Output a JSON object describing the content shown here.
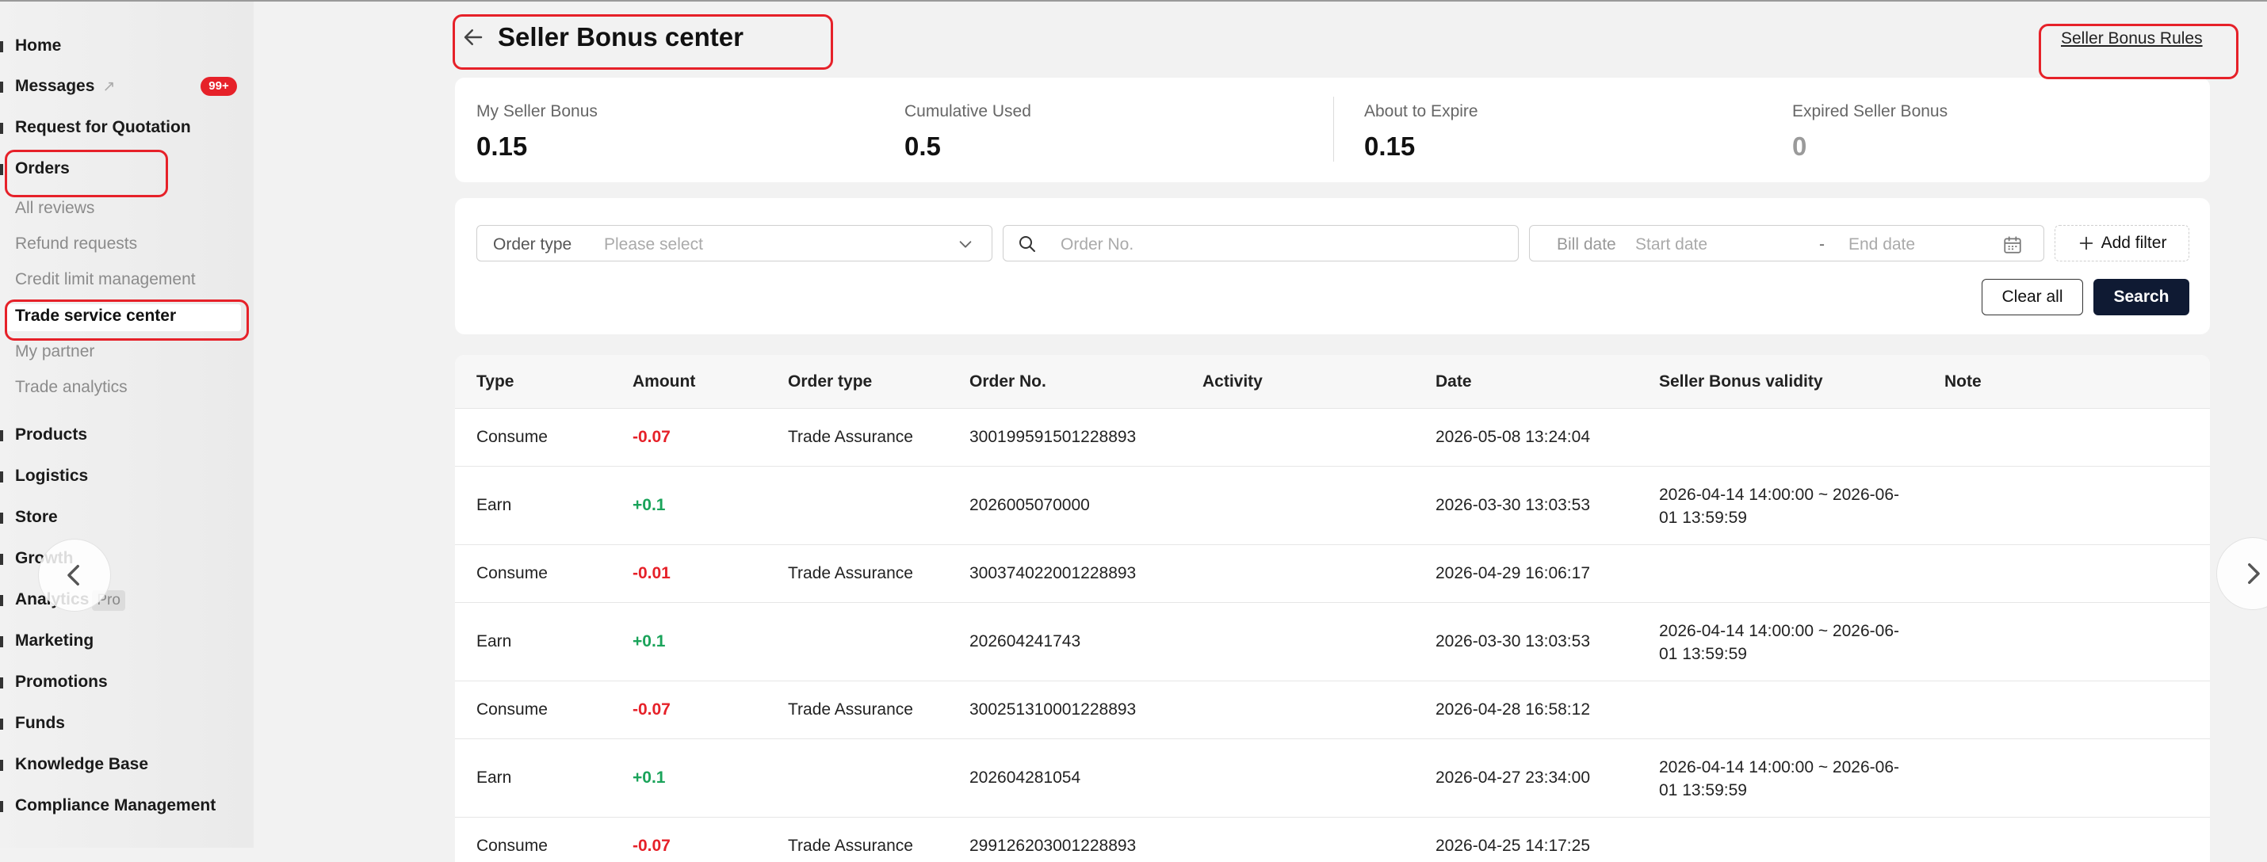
{
  "sidebar": {
    "items": [
      {
        "label": "Home"
      },
      {
        "label": "Messages",
        "badge": "99+"
      },
      {
        "label": "Request for Quotation"
      },
      {
        "label": "Orders"
      },
      {
        "label": "Products"
      },
      {
        "label": "Logistics"
      },
      {
        "label": "Store"
      },
      {
        "label": "Growth"
      },
      {
        "label": "Analytics",
        "tag": "Pro"
      },
      {
        "label": "Marketing"
      },
      {
        "label": "Promotions"
      },
      {
        "label": "Funds"
      },
      {
        "label": "Knowledge Base"
      },
      {
        "label": "Compliance Management"
      }
    ],
    "orders_sub": [
      {
        "label": "All reviews"
      },
      {
        "label": "Refund requests"
      },
      {
        "label": "Credit limit management"
      },
      {
        "label": "Trade service center",
        "active": true
      },
      {
        "label": "My partner"
      },
      {
        "label": "Trade analytics"
      }
    ]
  },
  "header": {
    "title": "Seller Bonus center",
    "rules_link": "Seller Bonus Rules"
  },
  "stats": [
    {
      "label": "My Seller Bonus",
      "value": "0.15"
    },
    {
      "label": "Cumulative Used",
      "value": "0.5"
    },
    {
      "label": "About to Expire",
      "value": "0.15"
    },
    {
      "label": "Expired Seller Bonus",
      "value": "0"
    }
  ],
  "filters": {
    "order_type_label": "Order type",
    "order_type_placeholder": "Please select",
    "order_no_placeholder": "Order No.",
    "bill_date_label": "Bill date",
    "start_date_placeholder": "Start date",
    "date_separator": "-",
    "end_date_placeholder": "End date",
    "add_filter": "Add filter",
    "clear_all": "Clear all",
    "search": "Search"
  },
  "table": {
    "columns": [
      "Type",
      "Amount",
      "Order type",
      "Order No.",
      "Activity",
      "Date",
      "Seller Bonus validity",
      "Note"
    ],
    "rows": [
      {
        "type": "Consume",
        "amount": "-0.07",
        "order_type": "Trade Assurance",
        "order_no": "300199591501228893",
        "activity": "",
        "date": "2026-05-08 13:24:04",
        "validity": "",
        "note": ""
      },
      {
        "type": "Earn",
        "amount": "+0.1",
        "order_type": "",
        "order_no": "2026005070000",
        "activity": "",
        "date": "2026-03-30 13:03:53",
        "validity": "2026-04-14 14:00:00 ~ 2026-06-01 13:59:59",
        "note": ""
      },
      {
        "type": "Consume",
        "amount": "-0.01",
        "order_type": "Trade Assurance",
        "order_no": "300374022001228893",
        "activity": "",
        "date": "2026-04-29 16:06:17",
        "validity": "",
        "note": ""
      },
      {
        "type": "Earn",
        "amount": "+0.1",
        "order_type": "",
        "order_no": "202604241743",
        "activity": "",
        "date": "2026-03-30 13:03:53",
        "validity": "2026-04-14 14:00:00 ~ 2026-06-01 13:59:59",
        "note": ""
      },
      {
        "type": "Consume",
        "amount": "-0.07",
        "order_type": "Trade Assurance",
        "order_no": "300251310001228893",
        "activity": "",
        "date": "2026-04-28 16:58:12",
        "validity": "",
        "note": ""
      },
      {
        "type": "Earn",
        "amount": "+0.1",
        "order_type": "",
        "order_no": "202604281054",
        "activity": "",
        "date": "2026-04-27 23:34:00",
        "validity": "2026-04-14 14:00:00 ~ 2026-06-01 13:59:59",
        "note": ""
      },
      {
        "type": "Consume",
        "amount": "-0.07",
        "order_type": "Trade Assurance",
        "order_no": "299126203001228893",
        "activity": "",
        "date": "2026-04-25 14:17:25",
        "validity": "",
        "note": ""
      }
    ]
  },
  "colors": {
    "accent_red": "#e62129",
    "positive_green": "#1aa35a",
    "primary_dark": "#0f1a33"
  },
  "icons": [
    "back-arrow-icon",
    "chevron-down-icon",
    "search-icon",
    "calendar-icon",
    "plus-icon",
    "chevron-left-icon",
    "chevron-right-icon",
    "external-link-icon"
  ]
}
